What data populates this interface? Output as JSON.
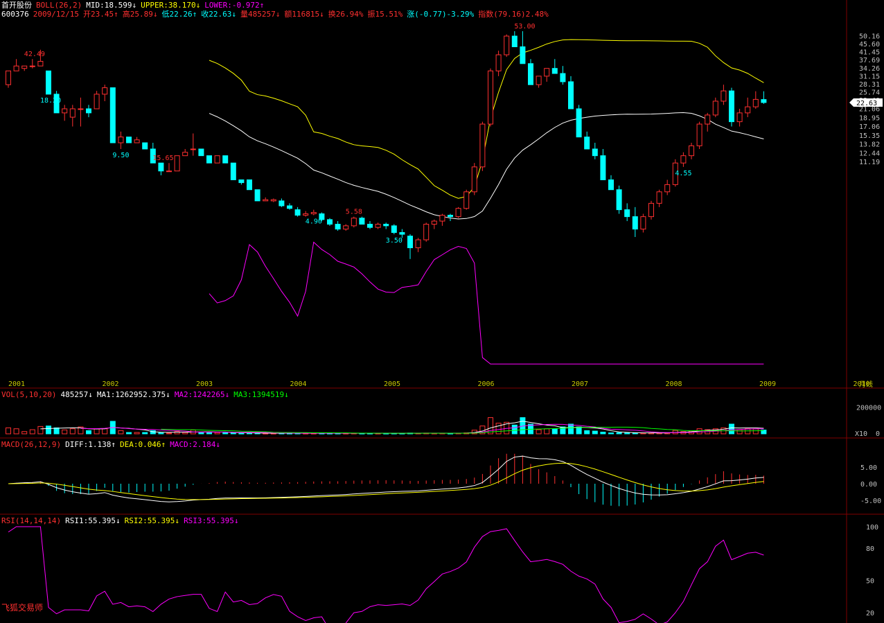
{
  "header": {
    "stock_name": "首开股份",
    "boll_label": "BOLL(26,2)",
    "mid": "MID:18.599↓",
    "upper": "UPPER:38.170↓",
    "lower": "LOWER:-0.972↑",
    "code": "600376",
    "date": "2009/12/15",
    "open": "开23.45↑",
    "high": "高25.89↓",
    "low": "低22.26↑",
    "close": "收22.63↓",
    "volume": "量485257↓",
    "amount": "额116815↓",
    "turnover": "换26.94%",
    "amplitude": "振15.51%",
    "change": "涨(-0.77)-3.29%",
    "index": "指数(79.16)2.48%"
  },
  "vol_header": {
    "label": "VOL(5,10,20)",
    "value": "485257↓",
    "ma1": "MA1:1262952.375↓",
    "ma2": "MA2:1242265↓",
    "ma3": "MA3:1394519↓"
  },
  "macd_header": {
    "label": "MACD(26,12,9)",
    "diff": "DIFF:1.138↑",
    "dea": "DEA:0.046↑",
    "macd": "MACD:2.184↓"
  },
  "rsi_header": {
    "label": "RSI(14,14,14)",
    "rsi1": "RSI1:55.395↓",
    "rsi2": "RSI2:55.395↓",
    "rsi3": "RSI3:55.395↓"
  },
  "brand": "飞狐交易师",
  "period_label": "月线",
  "colors": {
    "up": "#ff3030",
    "down": "#00ffff",
    "mid": "#ffffff",
    "upper": "#ffff00",
    "lower": "#ff00ff",
    "ma1": "#ffffff",
    "ma2": "#ff00ff",
    "ma3": "#00ff00",
    "diff": "#ffffff",
    "dea": "#ffff00",
    "axis": "#c0c0c0",
    "grid": "#800000"
  },
  "chart_data": {
    "type": "candlestick",
    "x_labels": [
      "2001",
      "2002",
      "2003",
      "2004",
      "2005",
      "2006",
      "2007",
      "2008",
      "2009",
      "2010"
    ],
    "price_ticks": [
      "50.16",
      "45.60",
      "41.45",
      "37.69",
      "34.26",
      "31.15",
      "28.31",
      "25.74",
      "23.40",
      "21.06",
      "18.95",
      "17.06",
      "15.35",
      "13.82",
      "12.44",
      "11.19"
    ],
    "current_price": "22.63",
    "annotations": [
      {
        "text": "42.49",
        "index": 3
      },
      {
        "text": "18.20",
        "index": 5
      },
      {
        "text": "9.50",
        "index": 14
      },
      {
        "text": "15.65",
        "index": 19
      },
      {
        "text": "4.90",
        "index": 38
      },
      {
        "text": "5.58",
        "index": 43
      },
      {
        "text": "3.50",
        "index": 48
      },
      {
        "text": "53.00",
        "index": 64
      },
      {
        "text": "4.55",
        "index": 84
      }
    ],
    "candles": [
      [
        28,
        33,
        27,
        33
      ],
      [
        33,
        38,
        33,
        35
      ],
      [
        34,
        35,
        33,
        35
      ],
      [
        35,
        38,
        34,
        35
      ],
      [
        35,
        42.49,
        35,
        37
      ],
      [
        33,
        33,
        25,
        25
      ],
      [
        25,
        26,
        20,
        20
      ],
      [
        20,
        22,
        18.2,
        21
      ],
      [
        19,
        22,
        17,
        21
      ],
      [
        21,
        24,
        17,
        21
      ],
      [
        21,
        22,
        19,
        20
      ],
      [
        21,
        26,
        21,
        25
      ],
      [
        25,
        28,
        23,
        27
      ],
      [
        27,
        27,
        14,
        14
      ],
      [
        14,
        16,
        13,
        15
      ],
      [
        15,
        15,
        14,
        14
      ],
      [
        14,
        15,
        14,
        14.5
      ],
      [
        14,
        14,
        13,
        13
      ],
      [
        13,
        14,
        11,
        11
      ],
      [
        11,
        11,
        9.5,
        10
      ],
      [
        10,
        11,
        10,
        10
      ],
      [
        10,
        12,
        10,
        12
      ],
      [
        12,
        13,
        12,
        12.5
      ],
      [
        13,
        15.65,
        12,
        13
      ],
      [
        13,
        13,
        12,
        12
      ],
      [
        12,
        12,
        11,
        11
      ],
      [
        11,
        12,
        11,
        12
      ],
      [
        12,
        12,
        11,
        11
      ],
      [
        11,
        11,
        9,
        9
      ],
      [
        9,
        9,
        8.5,
        8.7
      ],
      [
        9,
        9,
        8,
        8
      ],
      [
        8,
        8,
        7,
        7
      ],
      [
        7,
        7.3,
        7,
        7.1
      ],
      [
        7,
        7.2,
        6.9,
        7.1
      ],
      [
        7,
        7.2,
        6.5,
        6.6
      ],
      [
        6.6,
        6.8,
        6.3,
        6.4
      ],
      [
        6.3,
        6.5,
        5.8,
        5.9
      ],
      [
        5.9,
        6.2,
        5.8,
        6.0
      ],
      [
        6,
        6.3,
        5.9,
        6.1
      ],
      [
        6,
        6.1,
        5.5,
        5.6
      ],
      [
        5.6,
        5.7,
        5.2,
        5.3
      ],
      [
        5.3,
        5.5,
        4.9,
        5.0
      ],
      [
        5,
        5.3,
        4.9,
        5.2
      ],
      [
        5.2,
        5.8,
        5.1,
        5.7
      ],
      [
        5.7,
        5.8,
        5.3,
        5.3
      ],
      [
        5.3,
        5.5,
        5.0,
        5.1
      ],
      [
        5.1,
        5.4,
        5.0,
        5.3
      ],
      [
        5.3,
        5.4,
        5.0,
        5.2
      ],
      [
        5.2,
        5.3,
        4.7,
        4.8
      ],
      [
        4.8,
        5.0,
        4.5,
        4.7
      ],
      [
        4.6,
        4.7,
        3.5,
        4.0
      ],
      [
        4,
        4.5,
        3.8,
        4.4
      ],
      [
        4.4,
        5.4,
        4.3,
        5.3
      ],
      [
        5.3,
        5.6,
        5.0,
        5.5
      ],
      [
        5.5,
        6.0,
        5.2,
        5.9
      ],
      [
        5.9,
        6.0,
        5.5,
        5.8
      ],
      [
        5.8,
        6.5,
        5.7,
        6.4
      ],
      [
        6.4,
        8.0,
        6.3,
        7.8
      ],
      [
        7.8,
        11,
        7.5,
        10.5
      ],
      [
        10.5,
        18,
        10,
        17.5
      ],
      [
        17.5,
        34,
        17,
        33
      ],
      [
        33,
        42,
        31,
        40
      ],
      [
        40,
        51,
        39,
        50
      ],
      [
        50,
        53,
        44,
        44
      ],
      [
        44,
        53,
        36,
        36
      ],
      [
        36,
        38,
        28,
        28
      ],
      [
        28,
        31,
        27,
        31
      ],
      [
        31,
        34,
        29,
        34
      ],
      [
        34,
        38,
        33,
        32
      ],
      [
        32,
        35,
        28,
        29
      ],
      [
        29,
        31,
        21,
        21
      ],
      [
        21,
        22,
        15,
        15
      ],
      [
        15,
        16,
        13,
        13
      ],
      [
        13,
        14,
        11.5,
        12
      ],
      [
        12,
        13,
        9,
        9
      ],
      [
        9,
        9.5,
        8,
        8
      ],
      [
        8,
        8.4,
        6,
        6.3
      ],
      [
        6.3,
        6.8,
        5.5,
        5.8
      ],
      [
        5.8,
        6.5,
        4.55,
        5
      ],
      [
        5,
        6,
        4.8,
        5.8
      ],
      [
        5.8,
        7,
        5.6,
        6.8
      ],
      [
        6.8,
        8,
        6.5,
        7.8
      ],
      [
        7.8,
        9,
        7.5,
        8.5
      ],
      [
        8.5,
        11.5,
        8.3,
        11
      ],
      [
        11,
        12.5,
        10.5,
        12
      ],
      [
        12,
        14,
        11.5,
        13.5
      ],
      [
        13.5,
        18,
        13,
        17.5
      ],
      [
        17.5,
        20,
        16,
        19.5
      ],
      [
        19.5,
        24,
        19,
        23
      ],
      [
        23,
        28,
        22,
        26
      ],
      [
        26,
        27,
        17,
        18
      ],
      [
        18,
        21,
        17,
        20
      ],
      [
        20,
        24,
        19,
        21.5
      ],
      [
        21.5,
        25.89,
        21,
        23.5
      ],
      [
        23.45,
        25.89,
        22.26,
        22.63
      ]
    ],
    "boll_note": "BOLL(26,2) lines",
    "vol_ticks": [
      "200000",
      "0"
    ],
    "vol_unit": "X10",
    "macd_ticks": [
      "5.00",
      "0.00",
      "-5.00"
    ],
    "rsi_ticks": [
      "100",
      "80",
      "50",
      "20"
    ]
  }
}
